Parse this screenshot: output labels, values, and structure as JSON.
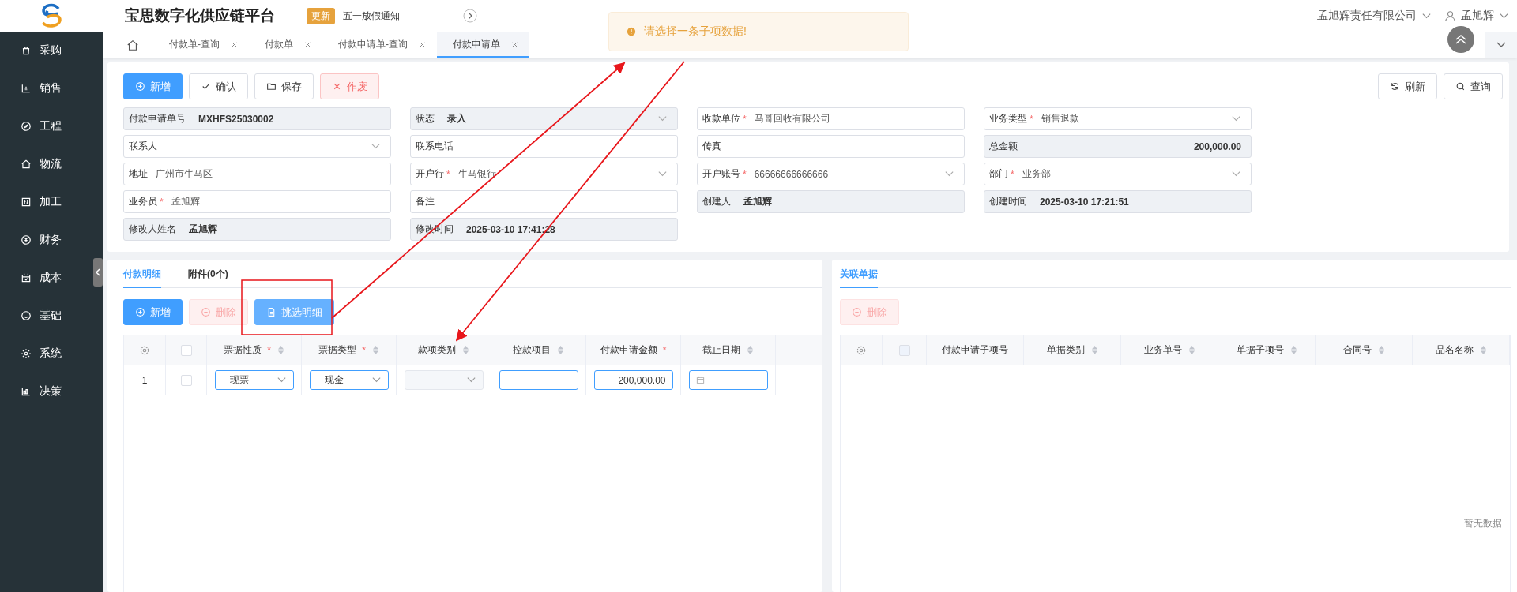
{
  "header": {
    "title": "宝思数字化供应链平台",
    "notice_badge": "更新",
    "notice": "五一放假通知",
    "company": "孟旭辉责任有限公司",
    "user": "孟旭辉"
  },
  "sidebar": {
    "items": [
      {
        "label": "采购"
      },
      {
        "label": "销售"
      },
      {
        "label": "工程"
      },
      {
        "label": "物流"
      },
      {
        "label": "加工"
      },
      {
        "label": "财务"
      },
      {
        "label": "成本"
      },
      {
        "label": "基础"
      },
      {
        "label": "系统"
      },
      {
        "label": "决策"
      }
    ]
  },
  "tabs": [
    {
      "label": "付款单-查询",
      "selected": false
    },
    {
      "label": "付款单",
      "selected": false
    },
    {
      "label": "付款申请单-查询",
      "selected": false
    },
    {
      "label": "付款申请单",
      "selected": true
    }
  ],
  "toast": {
    "text": "请选择一条子项数据!"
  },
  "toolbar": {
    "left": [
      {
        "label": "新增",
        "kind": "primary"
      },
      {
        "label": "确认",
        "kind": "default"
      },
      {
        "label": "保存",
        "kind": "default"
      },
      {
        "label": "作废",
        "kind": "danger"
      }
    ],
    "right": [
      {
        "label": "刷新",
        "kind": "default"
      },
      {
        "label": "查询",
        "kind": "default"
      }
    ]
  },
  "form": {
    "fields": [
      {
        "label": "付款申请单号",
        "value": "MXHFS25030002",
        "kind": "input",
        "readonly": true
      },
      {
        "label": "状态",
        "value": "录入",
        "kind": "select",
        "readonly": true
      },
      {
        "label": "收款单位",
        "mark": "*",
        "value": "马哥回收有限公司",
        "kind": "input",
        "readonly": false
      },
      {
        "label": "业务类型",
        "mark": "*",
        "value": "销售退款",
        "kind": "select",
        "readonly": false
      },
      {
        "label": "联系人",
        "kind": "select",
        "readonly": false
      },
      {
        "label": "联系电话",
        "kind": "input",
        "readonly": false
      },
      {
        "label": "传真",
        "kind": "input",
        "readonly": false
      },
      {
        "label": "总金额",
        "value": "200,000.00",
        "kind": "amount",
        "readonly": true
      },
      {
        "label": "地址",
        "value": "广州市牛马区",
        "kind": "input",
        "readonly": false
      },
      {
        "label": "开户行",
        "mark": "*",
        "value": "牛马银行",
        "kind": "select",
        "readonly": false
      },
      {
        "label": "开户账号",
        "mark": "*",
        "value": "66666666666666",
        "kind": "select",
        "readonly": false
      },
      {
        "label": "部门",
        "mark": "*",
        "value": "业务部",
        "kind": "select",
        "readonly": false
      },
      {
        "label": "业务员",
        "mark": "*",
        "value": "孟旭辉",
        "kind": "input",
        "readonly": false
      },
      {
        "label": "备注",
        "kind": "input",
        "readonly": false
      },
      {
        "label": "创建人",
        "value": "孟旭辉",
        "kind": "input",
        "readonly": true
      },
      {
        "label": "创建时间",
        "value": "2025-03-10 17:21:51",
        "kind": "input",
        "readonly": true
      },
      {
        "label": "修改人姓名",
        "value": "孟旭辉",
        "kind": "input",
        "readonly": true
      },
      {
        "label": "修改时间",
        "value": "2025-03-10 17:41:28",
        "kind": "input",
        "readonly": true
      }
    ]
  },
  "detail_panel": {
    "tabs": [
      {
        "label": "付款明细",
        "selected": true
      },
      {
        "label": "附件(0个)",
        "selected": false
      }
    ],
    "buttons": [
      {
        "label": "新增",
        "kind": "primary",
        "disabled": false
      },
      {
        "label": "删除",
        "kind": "danger",
        "disabled": true
      },
      {
        "label": "挑选明细",
        "kind": "primary",
        "disabled": true
      }
    ],
    "table": {
      "checked": false,
      "columns": [
        {
          "label": "票据性质",
          "mark": "*",
          "sortable": true
        },
        {
          "label": "票据类型",
          "mark": "*",
          "sortable": true
        },
        {
          "label": "款项类别",
          "sortable": true
        },
        {
          "label": "控款项目",
          "sortable": true
        },
        {
          "label": "付款申请金额",
          "mark": "*",
          "sortable": false
        },
        {
          "label": "截止日期",
          "sortable": true
        }
      ],
      "rows": [
        {
          "index": "1",
          "checked": false,
          "cells": [
            {
              "kind": "select",
              "value": "现票",
              "disabled": false
            },
            {
              "kind": "select",
              "value": "现金",
              "disabled": false
            },
            {
              "kind": "select",
              "disabled": true
            },
            {
              "kind": "input",
              "disabled": false
            },
            {
              "kind": "number",
              "value": "200,000.00",
              "disabled": false
            },
            {
              "kind": "date",
              "disabled": false
            }
          ]
        }
      ]
    }
  },
  "related_panel": {
    "tabs": [
      {
        "label": "关联单据",
        "selected": true
      }
    ],
    "buttons": [
      {
        "label": "删除",
        "kind": "danger",
        "disabled": true
      }
    ],
    "table": {
      "checked": false,
      "columns": [
        {
          "label": "付款申请子项号",
          "sortable": false
        },
        {
          "label": "单据类别",
          "sortable": true
        },
        {
          "label": "业务单号",
          "sortable": true
        },
        {
          "label": "单据子项号",
          "sortable": true
        },
        {
          "label": "合同号",
          "sortable": true
        },
        {
          "label": "品名名称",
          "sortable": true
        }
      ],
      "empty_text": "暂无数据"
    }
  }
}
